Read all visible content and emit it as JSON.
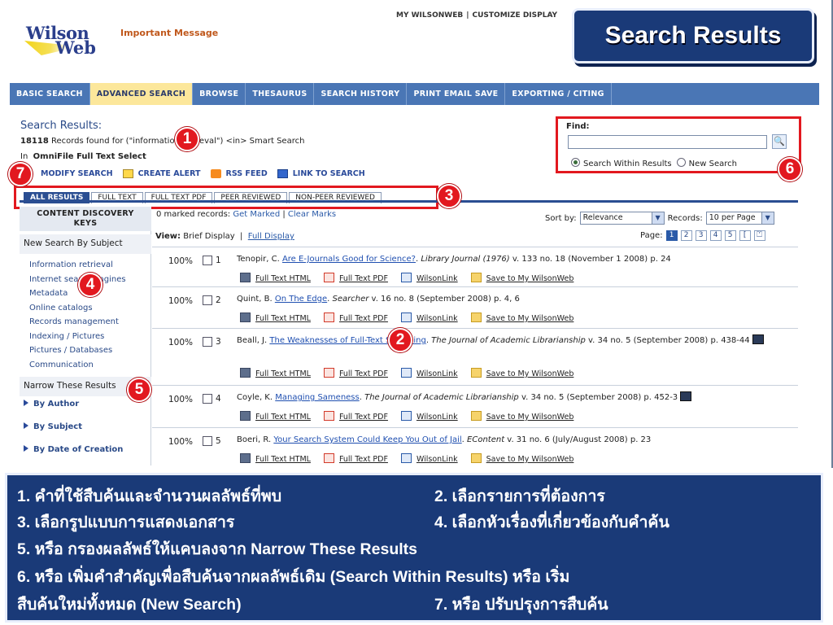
{
  "slide_title": "Search Results",
  "header": {
    "logo_line1": "Wilson",
    "logo_line2": "Web",
    "important_message": "Important Message",
    "top_links": [
      "MY WILSONWEB",
      "CUSTOMIZE DISPLAY"
    ]
  },
  "nav": {
    "tabs": [
      "BASIC SEARCH",
      "ADVANCED SEARCH",
      "BROWSE",
      "THESAURUS",
      "SEARCH HISTORY",
      "PRINT EMAIL SAVE",
      "EXPORTING / CITING"
    ],
    "active": "ADVANCED SEARCH"
  },
  "results_header": {
    "title": "Search Results:",
    "count": "18118",
    "found_text": " Records found for (\"information retrieval\") <in> Smart Search",
    "in_label": "In",
    "database": "OmniFile Full Text Select"
  },
  "actions": [
    "MODIFY SEARCH",
    "CREATE ALERT",
    "RSS FEED",
    "LINK TO SEARCH"
  ],
  "find": {
    "label": "Find:",
    "value": "",
    "button": "🔍",
    "option1": "Search Within Results",
    "option2": "New Search",
    "selected": "Search Within Results"
  },
  "filter_tabs": [
    "ALL RESULTS",
    "FULL TEXT",
    "FULL TEXT PDF",
    "PEER REVIEWED",
    "NON-PEER REVIEWED"
  ],
  "sidebar": {
    "heading_line1": "CONTENT DISCOVERY",
    "heading_line2": "KEYS",
    "new_search_by_subject": "New Search By Subject",
    "subjects": [
      "Information retrieval",
      "Internet search engines",
      "Metadata",
      "Online catalogs",
      "Records management",
      "Indexing / Pictures",
      "Pictures / Databases",
      "Communication"
    ],
    "narrow_heading": "Narrow These Results",
    "narrow": [
      "By Author",
      "By Subject",
      "By Date of Creation"
    ]
  },
  "results_bar": {
    "marked": "0 marked records:",
    "get_marked": "Get Marked",
    "clear_marks": "Clear Marks",
    "view_label": "View:",
    "brief": "Brief Display",
    "full": "Full Display",
    "sort_label": "Sort by:",
    "sort_value": "Relevance",
    "records_label": "Records:",
    "records_value": "10 per Page",
    "page_label": "Page:",
    "pages": [
      "1",
      "2",
      "3",
      "4",
      "5",
      "[",
      "⏍"
    ]
  },
  "record_links": {
    "html": "Full Text HTML",
    "pdf": "Full Text PDF",
    "wl": "WilsonLink",
    "save": "Save to My WilsonWeb"
  },
  "records": [
    {
      "pct": "100%",
      "num": "1",
      "author": "Tenopir, C. ",
      "title": "Are E-Journals Good for Science?",
      "sep": ". ",
      "journal": "Library Journal (1976)",
      "rest": " v. 133 no. 18 (November 1 2008) p. 24"
    },
    {
      "pct": "100%",
      "num": "2",
      "author": "Quint, B. ",
      "title": "On The Edge",
      "sep": ". ",
      "journal": "Searcher",
      "rest": " v. 16 no. 8 (September 2008) p. 4, 6"
    },
    {
      "pct": "100%",
      "num": "3",
      "author": "Beall, J. ",
      "title": "The Weaknesses of Full-Text Searching",
      "sep": ". ",
      "journal": "The Journal of Academic Librarianship",
      "rest": " v. 34 no. 5 (September 2008) p. 438-44"
    },
    {
      "pct": "100%",
      "num": "4",
      "author": "Coyle, K. ",
      "title": "Managing Sameness",
      "sep": ". ",
      "journal": "The Journal of Academic Librarianship",
      "rest": " v. 34 no. 5 (September 2008) p. 452-3"
    },
    {
      "pct": "100%",
      "num": "5",
      "author": "Boeri, R. ",
      "title": "Your Search System Could Keep You Out of Jail",
      "sep": ". ",
      "journal": "EContent",
      "rest": " v. 31 no. 6 (July/August 2008) p. 23"
    }
  ],
  "callouts": [
    "1",
    "2",
    "3",
    "4",
    "5",
    "6",
    "7"
  ],
  "legend": {
    "l1a": "1. คำที่ใช้สืบค้นและจำนวนผลลัพธ์ที่พบ",
    "l1b": "2. เลือกรายการที่ต้องการ",
    "l2a": "3. เลือกรูปแบบการแสดงเอกสาร",
    "l2b": "4. เลือกหัวเรื่องที่เกี่ยวข้องกับคำค้น",
    "l3": "5. หรือ กรองผลลัพธ์ให้แคบลงจาก Narrow These Results",
    "l4": "6. หรือ เพิ่มคำสำคัญเพื่อสืบค้นจากผลลัพธ์เดิม (Search Within Results) หรือ เริ่ม",
    "l5a": "สืบค้นใหม่ทั้งหมด (New Search)",
    "l5b": "7.  หรือ ปรับปรุงการสืบค้น"
  },
  "colors": {
    "navy": "#1a3a78",
    "nav_blue": "#4a76b5",
    "active_tab": "#fce79b",
    "callout_red": "#e2181f"
  }
}
